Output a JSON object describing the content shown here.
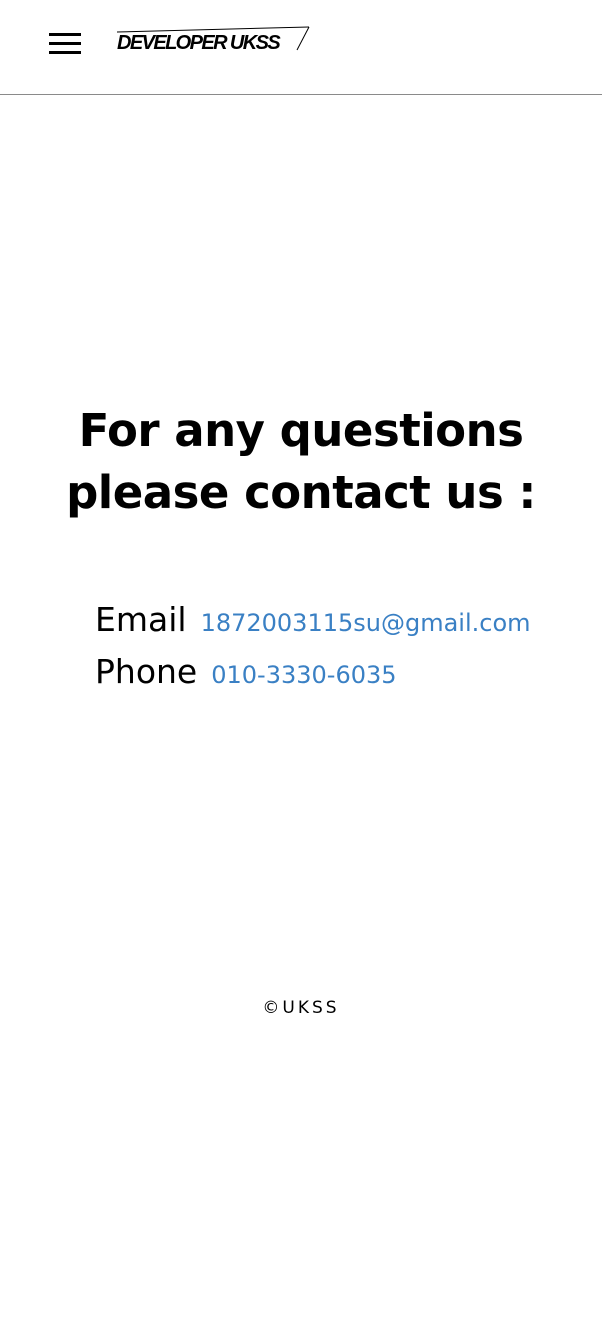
{
  "header": {
    "menu_icon": "hamburger-menu-icon",
    "logo_text": "DEVELOPER UKSS"
  },
  "main": {
    "heading_line1": "For any questions",
    "heading_line2": "please contact us :",
    "contacts": {
      "email_label": "Email",
      "email_value": "1872003115su@gmail.com",
      "phone_label": "Phone",
      "phone_value": "010-3330-6035"
    }
  },
  "footer": {
    "copyright": "©UKSS"
  },
  "colors": {
    "link": "#3a80c4",
    "divider": "#8a8a8a",
    "text": "#000000"
  }
}
